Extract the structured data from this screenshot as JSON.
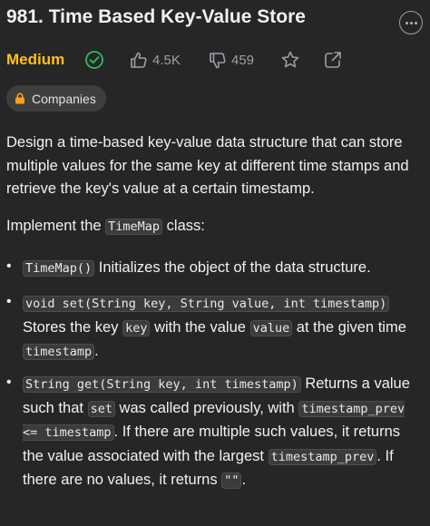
{
  "problem": {
    "title": "981. Time Based Key-Value Store",
    "difficulty": "Medium",
    "likes": "4.5K",
    "dislikes": "459",
    "companies_label": "Companies"
  },
  "description": {
    "intro": "Design a time-based key-value data structure that can store multiple values for the same key at different time stamps and retrieve the key's value at a certain timestamp.",
    "implement_prefix": "Implement the",
    "class_name": "TimeMap",
    "implement_suffix": "class:",
    "items": [
      {
        "code": "TimeMap()",
        "text": "Initializes the object of the data structure."
      },
      {
        "code": "void set(String key, String value, int timestamp)",
        "text_1": "Stores the key",
        "code_key": "key",
        "text_2": "with the value",
        "code_value": "value",
        "text_3": "at the given time",
        "code_timestamp": "timestamp",
        "text_4": "."
      },
      {
        "code": "String get(String key, int timestamp)",
        "text_1": "Returns a value such that",
        "code_set": "set",
        "text_2": "was called previously, with",
        "code_cond": "timestamp_prev <= timestamp",
        "text_3": ". If there are multiple such values, it returns the value associated with the largest",
        "code_prev": "timestamp_prev",
        "text_4": ". If there are no values, it returns",
        "code_empty": "\"\"",
        "text_5": "."
      }
    ]
  },
  "colors": {
    "background": "#262626",
    "difficulty_medium": "#ffc01e",
    "solved_check": "#2cbb5d",
    "muted": "#9aa0a8",
    "lock": "#ffa116"
  },
  "icons": [
    "check-circle-icon",
    "thumbs-up-icon",
    "thumbs-down-icon",
    "star-icon",
    "share-icon",
    "more-icon",
    "lock-icon"
  ]
}
